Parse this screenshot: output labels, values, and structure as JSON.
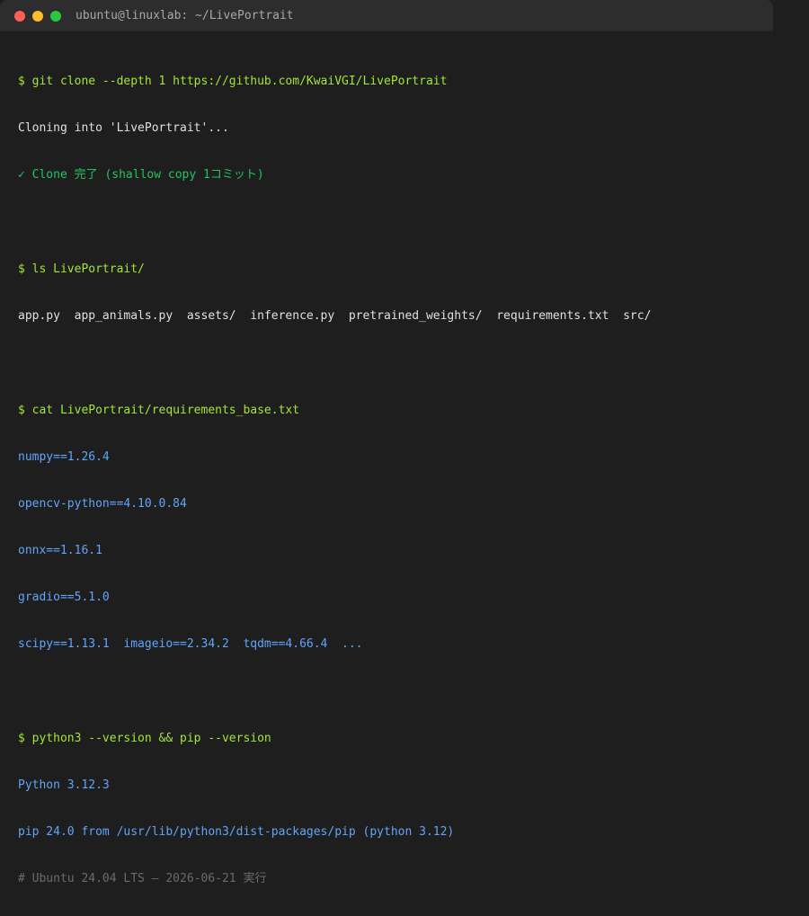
{
  "window": {
    "title": "ubuntu@linuxlab: ~/LivePortrait",
    "buttons": {
      "close": "close-button",
      "minimize": "minimize-button",
      "maximize": "maximize-button"
    }
  },
  "terminal": {
    "git_cmd": "$ git clone --depth 1 https://github.com/KwaiVGI/LivePortrait",
    "git_out": "Cloning into 'LivePortrait'...",
    "git_ok": "✓ Clone 完了 (shallow copy 1コミット)",
    "ls_cmd": "$ ls LivePortrait/",
    "ls_out": "app.py  app_animals.py  assets/  inference.py  pretrained_weights/  requirements.txt  src/",
    "cat_cmd": "$ cat LivePortrait/requirements_base.txt",
    "deps": [
      "numpy==1.26.4",
      "opencv-python==4.10.0.84",
      "onnx==1.16.1",
      "gradio==5.1.0",
      "scipy==1.13.1  imageio==2.34.2  tqdm==4.66.4  ..."
    ],
    "py_cmd": "$ python3 --version && pip --version",
    "py_out1": "Python 3.12.3",
    "py_out2": "pip 24.0 from /usr/lib/python3/dist-packages/pip (python 3.12)",
    "comment": "# Ubuntu 24.04 LTS — 2026-06-21 実行"
  }
}
